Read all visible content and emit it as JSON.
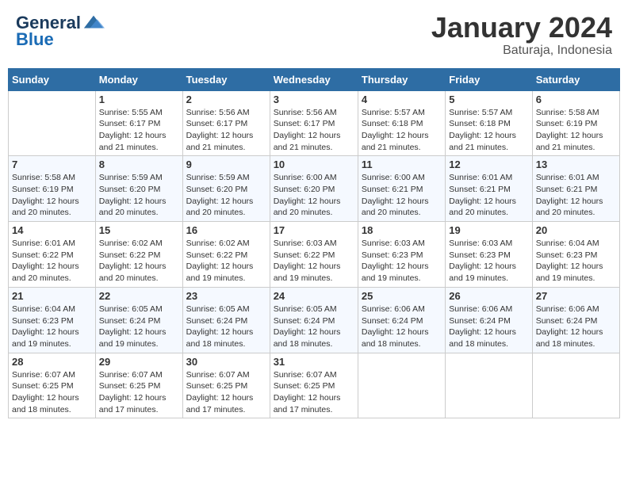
{
  "header": {
    "logo_general": "General",
    "logo_blue": "Blue",
    "month_title": "January 2024",
    "subtitle": "Baturaja, Indonesia"
  },
  "days_of_week": [
    "Sunday",
    "Monday",
    "Tuesday",
    "Wednesday",
    "Thursday",
    "Friday",
    "Saturday"
  ],
  "weeks": [
    [
      {
        "day": "",
        "sunrise": "",
        "sunset": "",
        "daylight": ""
      },
      {
        "day": "1",
        "sunrise": "Sunrise: 5:55 AM",
        "sunset": "Sunset: 6:17 PM",
        "daylight": "Daylight: 12 hours and 21 minutes."
      },
      {
        "day": "2",
        "sunrise": "Sunrise: 5:56 AM",
        "sunset": "Sunset: 6:17 PM",
        "daylight": "Daylight: 12 hours and 21 minutes."
      },
      {
        "day": "3",
        "sunrise": "Sunrise: 5:56 AM",
        "sunset": "Sunset: 6:17 PM",
        "daylight": "Daylight: 12 hours and 21 minutes."
      },
      {
        "day": "4",
        "sunrise": "Sunrise: 5:57 AM",
        "sunset": "Sunset: 6:18 PM",
        "daylight": "Daylight: 12 hours and 21 minutes."
      },
      {
        "day": "5",
        "sunrise": "Sunrise: 5:57 AM",
        "sunset": "Sunset: 6:18 PM",
        "daylight": "Daylight: 12 hours and 21 minutes."
      },
      {
        "day": "6",
        "sunrise": "Sunrise: 5:58 AM",
        "sunset": "Sunset: 6:19 PM",
        "daylight": "Daylight: 12 hours and 21 minutes."
      }
    ],
    [
      {
        "day": "7",
        "sunrise": "Sunrise: 5:58 AM",
        "sunset": "Sunset: 6:19 PM",
        "daylight": "Daylight: 12 hours and 20 minutes."
      },
      {
        "day": "8",
        "sunrise": "Sunrise: 5:59 AM",
        "sunset": "Sunset: 6:20 PM",
        "daylight": "Daylight: 12 hours and 20 minutes."
      },
      {
        "day": "9",
        "sunrise": "Sunrise: 5:59 AM",
        "sunset": "Sunset: 6:20 PM",
        "daylight": "Daylight: 12 hours and 20 minutes."
      },
      {
        "day": "10",
        "sunrise": "Sunrise: 6:00 AM",
        "sunset": "Sunset: 6:20 PM",
        "daylight": "Daylight: 12 hours and 20 minutes."
      },
      {
        "day": "11",
        "sunrise": "Sunrise: 6:00 AM",
        "sunset": "Sunset: 6:21 PM",
        "daylight": "Daylight: 12 hours and 20 minutes."
      },
      {
        "day": "12",
        "sunrise": "Sunrise: 6:01 AM",
        "sunset": "Sunset: 6:21 PM",
        "daylight": "Daylight: 12 hours and 20 minutes."
      },
      {
        "day": "13",
        "sunrise": "Sunrise: 6:01 AM",
        "sunset": "Sunset: 6:21 PM",
        "daylight": "Daylight: 12 hours and 20 minutes."
      }
    ],
    [
      {
        "day": "14",
        "sunrise": "Sunrise: 6:01 AM",
        "sunset": "Sunset: 6:22 PM",
        "daylight": "Daylight: 12 hours and 20 minutes."
      },
      {
        "day": "15",
        "sunrise": "Sunrise: 6:02 AM",
        "sunset": "Sunset: 6:22 PM",
        "daylight": "Daylight: 12 hours and 20 minutes."
      },
      {
        "day": "16",
        "sunrise": "Sunrise: 6:02 AM",
        "sunset": "Sunset: 6:22 PM",
        "daylight": "Daylight: 12 hours and 19 minutes."
      },
      {
        "day": "17",
        "sunrise": "Sunrise: 6:03 AM",
        "sunset": "Sunset: 6:22 PM",
        "daylight": "Daylight: 12 hours and 19 minutes."
      },
      {
        "day": "18",
        "sunrise": "Sunrise: 6:03 AM",
        "sunset": "Sunset: 6:23 PM",
        "daylight": "Daylight: 12 hours and 19 minutes."
      },
      {
        "day": "19",
        "sunrise": "Sunrise: 6:03 AM",
        "sunset": "Sunset: 6:23 PM",
        "daylight": "Daylight: 12 hours and 19 minutes."
      },
      {
        "day": "20",
        "sunrise": "Sunrise: 6:04 AM",
        "sunset": "Sunset: 6:23 PM",
        "daylight": "Daylight: 12 hours and 19 minutes."
      }
    ],
    [
      {
        "day": "21",
        "sunrise": "Sunrise: 6:04 AM",
        "sunset": "Sunset: 6:23 PM",
        "daylight": "Daylight: 12 hours and 19 minutes."
      },
      {
        "day": "22",
        "sunrise": "Sunrise: 6:05 AM",
        "sunset": "Sunset: 6:24 PM",
        "daylight": "Daylight: 12 hours and 19 minutes."
      },
      {
        "day": "23",
        "sunrise": "Sunrise: 6:05 AM",
        "sunset": "Sunset: 6:24 PM",
        "daylight": "Daylight: 12 hours and 18 minutes."
      },
      {
        "day": "24",
        "sunrise": "Sunrise: 6:05 AM",
        "sunset": "Sunset: 6:24 PM",
        "daylight": "Daylight: 12 hours and 18 minutes."
      },
      {
        "day": "25",
        "sunrise": "Sunrise: 6:06 AM",
        "sunset": "Sunset: 6:24 PM",
        "daylight": "Daylight: 12 hours and 18 minutes."
      },
      {
        "day": "26",
        "sunrise": "Sunrise: 6:06 AM",
        "sunset": "Sunset: 6:24 PM",
        "daylight": "Daylight: 12 hours and 18 minutes."
      },
      {
        "day": "27",
        "sunrise": "Sunrise: 6:06 AM",
        "sunset": "Sunset: 6:24 PM",
        "daylight": "Daylight: 12 hours and 18 minutes."
      }
    ],
    [
      {
        "day": "28",
        "sunrise": "Sunrise: 6:07 AM",
        "sunset": "Sunset: 6:25 PM",
        "daylight": "Daylight: 12 hours and 18 minutes."
      },
      {
        "day": "29",
        "sunrise": "Sunrise: 6:07 AM",
        "sunset": "Sunset: 6:25 PM",
        "daylight": "Daylight: 12 hours and 17 minutes."
      },
      {
        "day": "30",
        "sunrise": "Sunrise: 6:07 AM",
        "sunset": "Sunset: 6:25 PM",
        "daylight": "Daylight: 12 hours and 17 minutes."
      },
      {
        "day": "31",
        "sunrise": "Sunrise: 6:07 AM",
        "sunset": "Sunset: 6:25 PM",
        "daylight": "Daylight: 12 hours and 17 minutes."
      },
      {
        "day": "",
        "sunrise": "",
        "sunset": "",
        "daylight": ""
      },
      {
        "day": "",
        "sunrise": "",
        "sunset": "",
        "daylight": ""
      },
      {
        "day": "",
        "sunrise": "",
        "sunset": "",
        "daylight": ""
      }
    ]
  ]
}
